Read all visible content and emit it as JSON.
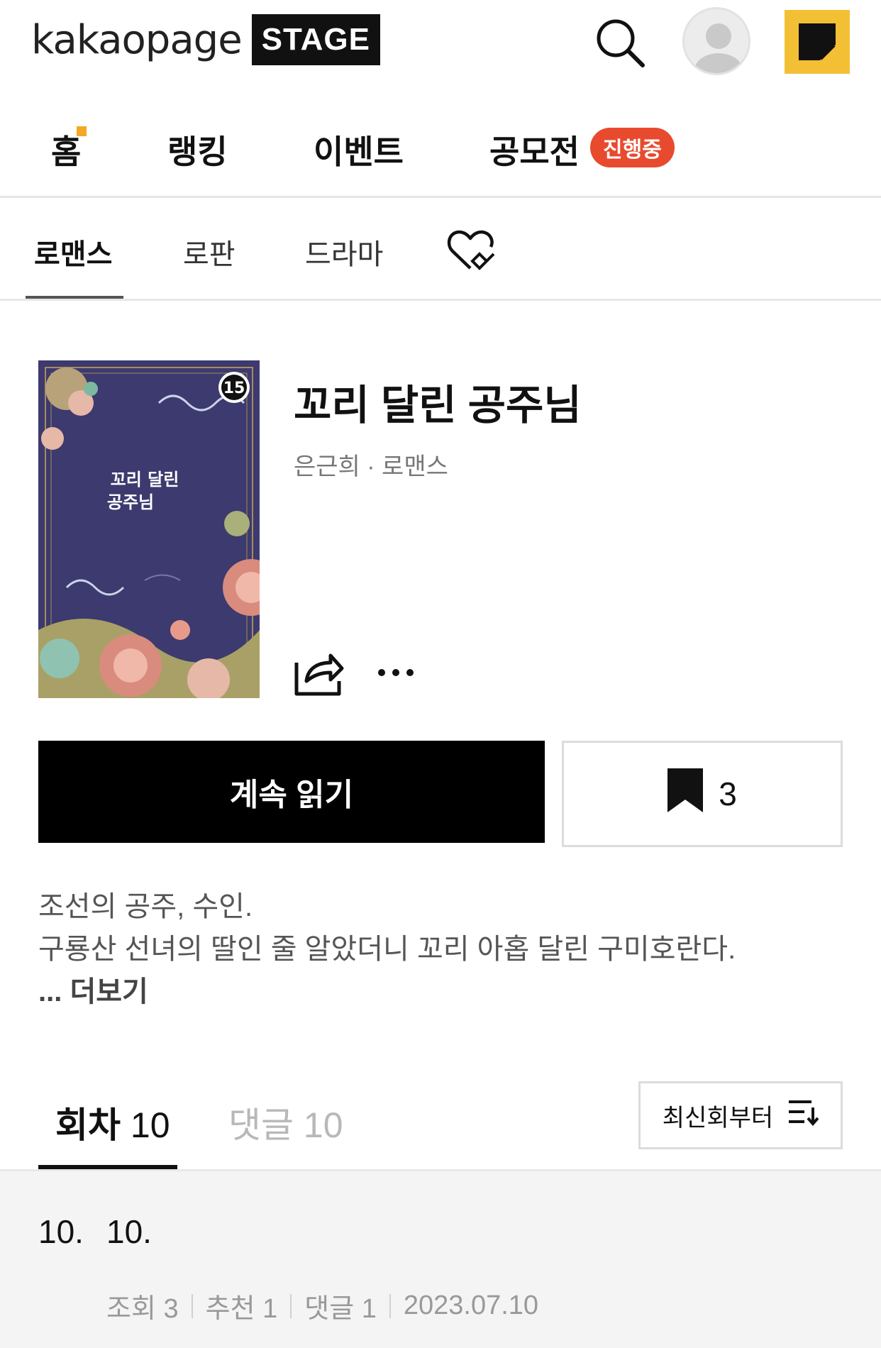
{
  "header": {
    "logo_text": "kakaopage",
    "logo_badge": "STAGE"
  },
  "main_nav": {
    "items": [
      {
        "label": "홈"
      },
      {
        "label": "랭킹"
      },
      {
        "label": "이벤트"
      },
      {
        "label": "공모전"
      }
    ],
    "contest_badge": "진행중"
  },
  "genre_tabs": {
    "items": [
      {
        "label": "로맨스",
        "active": true
      },
      {
        "label": "로판",
        "active": false
      },
      {
        "label": "드라마",
        "active": false
      }
    ]
  },
  "work": {
    "cover_age_rating": "15",
    "cover_title_line1": "꼬리 달린",
    "cover_title_line2": "공주님",
    "title": "꼬리 달린 공주님",
    "author_genre": "은근희 · 로맨스",
    "read_button": "계속 읽기",
    "bookmark_count": "3",
    "description_line1": "조선의 공주, 수인.",
    "description_line2": "구룡산 선녀의 딸인 줄 알았더니 꼬리 아홉 달린 구미호란다.",
    "more_prefix": "... ",
    "more_label": "더보기"
  },
  "episode_tabs": {
    "episodes_label": "회차",
    "episodes_count": "10",
    "comments_label": "댓글",
    "comments_count": "10",
    "sort_label": "최신회부터"
  },
  "episodes": [
    {
      "number": "10.",
      "title": "10.",
      "views": "조회 3",
      "recommends": "추천 1",
      "comments": "댓글 1",
      "date": "2023.07.10"
    }
  ],
  "colors": {
    "accent_yellow": "#f3c035",
    "badge_red": "#e84a2e",
    "cover_bg": "#3c3a6e"
  }
}
